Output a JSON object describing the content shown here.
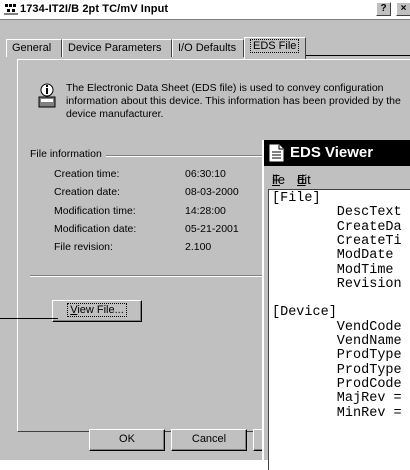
{
  "dialog": {
    "title": "1734-IT2I/B 2pt TC/mV Input",
    "help_label": "?",
    "close_label": "×",
    "tabs": [
      {
        "label": "General"
      },
      {
        "label": "Device Parameters"
      },
      {
        "label": "I/O Defaults"
      },
      {
        "label": "EDS File"
      }
    ],
    "active_tab": "EDS File",
    "description": "The Electronic Data Sheet (EDS file) is used to convey configuration information about this device. This information has been provided by the device manufacturer.",
    "file_info": {
      "group_label": "File information",
      "rows": [
        {
          "label": "Creation time:",
          "value": "06:30:10"
        },
        {
          "label": "Creation date:",
          "value": "08-03-2000"
        },
        {
          "label": "Modification time:",
          "value": "14:28:00"
        },
        {
          "label": "Modification date:",
          "value": "05-21-2001"
        },
        {
          "label": "File revision:",
          "value": "2.100"
        }
      ]
    },
    "view_file_button": {
      "label_prefix": "",
      "mnemonic": "V",
      "label_rest": "iew File..."
    },
    "ok_button": "OK",
    "cancel_button": "Cancel"
  },
  "viewer": {
    "title": "EDS Viewer",
    "menu": [
      {
        "mnemonic": "F",
        "rest": "ile"
      },
      {
        "mnemonic": "E",
        "rest": "dit"
      }
    ],
    "content_lines": [
      "[File]",
      "        DescText",
      "        CreateDa",
      "        CreateTi",
      "        ModDate ",
      "        ModTime ",
      "        Revision",
      "",
      "[Device]",
      "        VendCode",
      "        VendName",
      "        ProdType",
      "        ProdType",
      "        ProdCode",
      "        MajRev =",
      "        MinRev ="
    ]
  },
  "colors": {
    "dialog_bg": "#c0c0c0",
    "viewer_titlebar": "#000000"
  }
}
